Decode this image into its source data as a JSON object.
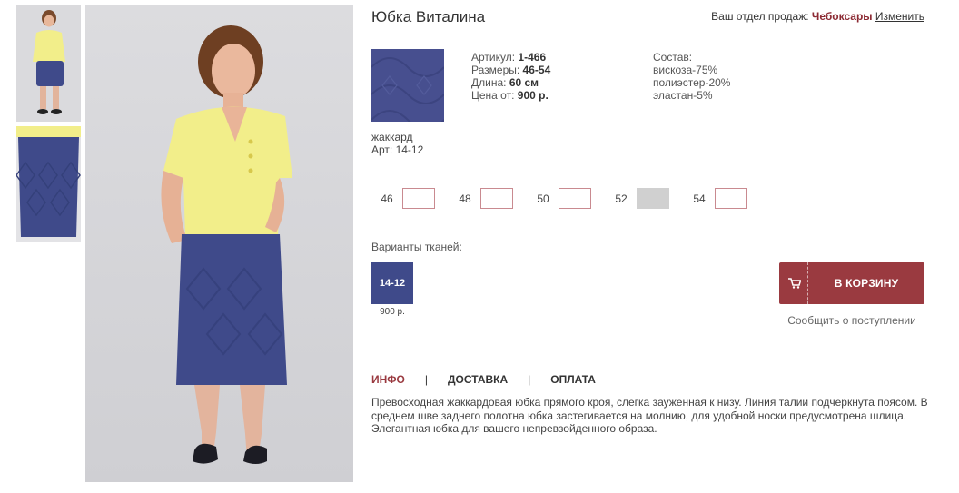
{
  "product": {
    "title": "Юбка Виталина"
  },
  "sales": {
    "label": "Ваш отдел продаж:",
    "city": "Чебоксары",
    "change_link": "Изменить"
  },
  "fabric": {
    "name": "жаккард",
    "art": "Арт: 14-12"
  },
  "specs": {
    "article_label": "Артикул:",
    "article_value": "1-466",
    "sizes_label": "Размеры:",
    "sizes_value": "46-54",
    "length_label": "Длина:",
    "length_value": "60 см",
    "price_label": "Цена от:",
    "price_value": "900 р."
  },
  "composition": {
    "label": "Состав:",
    "items": [
      "вискоза-75%",
      "полиэстер-20%",
      "эластан-5%"
    ]
  },
  "sizes": [
    {
      "label": "46",
      "available": true
    },
    {
      "label": "48",
      "available": true
    },
    {
      "label": "50",
      "available": true
    },
    {
      "label": "52",
      "available": false
    },
    {
      "label": "54",
      "available": true
    }
  ],
  "variants": {
    "label": "Варианты тканей:",
    "items": [
      {
        "code": "14-12",
        "price": "900 р.",
        "color": "#3f4a8a"
      }
    ]
  },
  "cart": {
    "button_label": "В КОРЗИНУ",
    "icon": "cart-icon",
    "notify_label": "Сообщить о поступлении"
  },
  "tabs": [
    {
      "label": "ИНФО",
      "active": true
    },
    {
      "label": "ДОСТАВКА",
      "active": false
    },
    {
      "label": "ОПЛАТА",
      "active": false
    }
  ],
  "tab_separator": "|",
  "description": "Превосходная жаккардовая юбка прямого кроя, слегка зауженная к низу. Линия талии подчеркнута поясом. В среднем шве заднего полотна юбка застегивается на молнию, для удобной носки предусмотрена шлица. Элегантная юбка для вашего непревзойденного образа.",
  "colors": {
    "accent": "#9a3a40",
    "city": "#8c2a33",
    "skirt": "#3f4a8a",
    "blouse": "#f2ee8a"
  }
}
